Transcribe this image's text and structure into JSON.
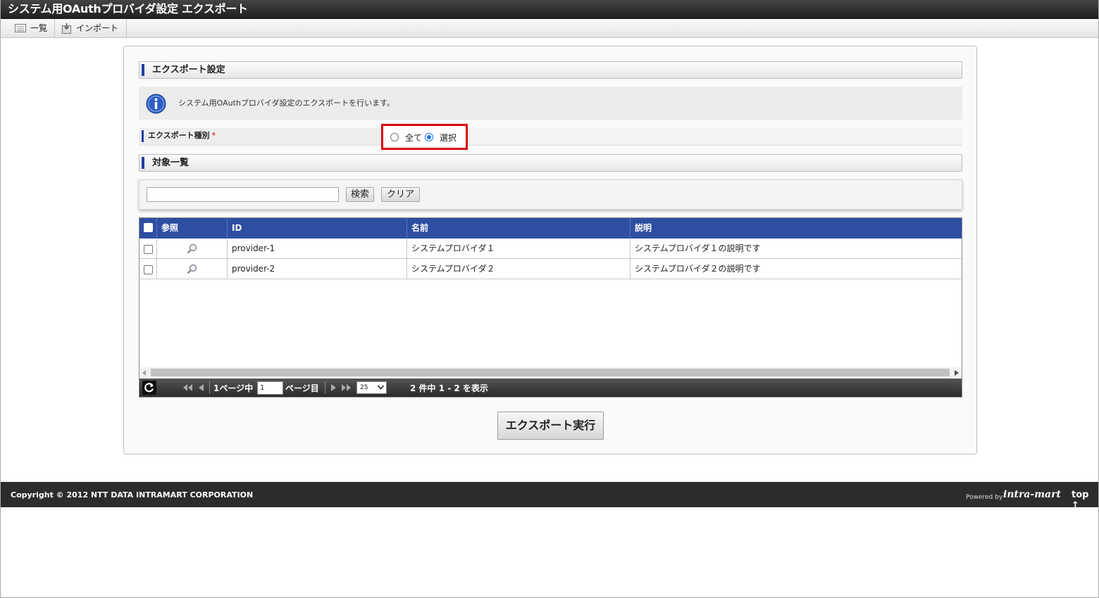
{
  "window": {
    "title": "システム用OAuthプロバイダ設定 エクスポート"
  },
  "menubar": {
    "items": [
      {
        "label": "一覧",
        "icon": "list-icon"
      },
      {
        "label": "インポート",
        "icon": "import-icon"
      }
    ]
  },
  "export_settings": {
    "title": "エクスポート設定",
    "info": "システム用OAuthプロバイダ設定のエクスポートを行います。",
    "type_label": "エクスポート種別",
    "required_mark": "*",
    "options": [
      {
        "label": "全て",
        "selected": false
      },
      {
        "label": "選択",
        "selected": true
      }
    ]
  },
  "target_list": {
    "title": "対象一覧",
    "search_value": "",
    "search_button": "検索",
    "clear_button": "クリア",
    "columns": [
      "参照",
      "ID",
      "名前",
      "説明"
    ],
    "rows": [
      {
        "id": "provider-1",
        "name": "システムプロバイダ１",
        "desc": "システムプロバイダ１の説明です",
        "checked": false
      },
      {
        "id": "provider-2",
        "name": "システムプロバイダ２",
        "desc": "システムプロバイダ２の説明です",
        "checked": false
      }
    ],
    "pager": {
      "page_prefix": "1ページ中",
      "page_value": "1",
      "page_suffix": "ページ目",
      "page_size": "25",
      "summary": "2 件中 1 - 2 を表示"
    }
  },
  "execute_button": "エクスポート実行",
  "footer": {
    "copyright": "Copyright © 2012 NTT DATA INTRAMART CORPORATION",
    "powered_by": "Powered by",
    "brand": "intra-mart",
    "top_link": "top ↑"
  },
  "colors": {
    "accent": "#2e4ea2",
    "highlight": "#dd0000",
    "titlebar": "#2a2a2a"
  }
}
